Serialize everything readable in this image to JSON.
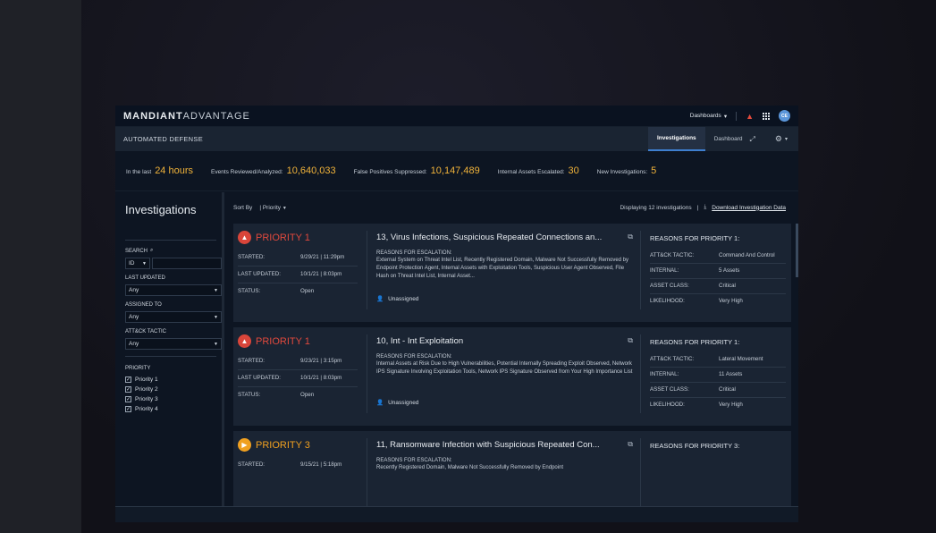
{
  "brand": {
    "bold": "MANDIANT",
    "light": "ADVANTAGE"
  },
  "topbar": {
    "dashboards_label": "Dashboards",
    "avatar_initials": "CE"
  },
  "subbar": {
    "title": "AUTOMATED DEFENSE",
    "tabs": [
      {
        "label": "Investigations",
        "active": true
      },
      {
        "label": "Dashboard",
        "active": false
      }
    ]
  },
  "stats": {
    "range_label": "In the last",
    "range_value": "24 hours",
    "events_label": "Events Reviewed/Analyzed:",
    "events_value": "10,640,033",
    "fp_label": "False Positives Suppressed:",
    "fp_value": "10,147,489",
    "assets_label": "Internal Assets Escalated:",
    "assets_value": "30",
    "new_label": "New Investigations:",
    "new_value": "5"
  },
  "sidebar": {
    "title": "Investigations",
    "search_label": "SEARCH",
    "search_field": "ID",
    "last_updated_label": "LAST UPDATED",
    "last_updated_value": "Any",
    "assigned_label": "ASSIGNED TO",
    "assigned_value": "Any",
    "tactic_label": "ATT&CK TACTIC",
    "tactic_value": "Any",
    "priority_label": "PRIORITY",
    "priorities": [
      "Priority 1",
      "Priority 2",
      "Priority 3",
      "Priority 4"
    ]
  },
  "list": {
    "sort_label": "Sort By",
    "sort_value": "Priority",
    "displaying": "Displaying 12 investigations",
    "download_label": "Download Investigation Data"
  },
  "labels": {
    "started": "STARTED:",
    "last_updated": "LAST UPDATED:",
    "status": "STATUS:",
    "reasons": "REASONS FOR ESCALATION:",
    "unassigned": "Unassigned",
    "tactic": "ATT&CK TACTIC:",
    "internal": "INTERNAL:",
    "asset_class": "ASSET CLASS:",
    "likelihood": "LIKELIHOOD:"
  },
  "cards": [
    {
      "priority": "PRIORITY 1",
      "level": "red",
      "started": "9/29/21 | 11:29pm",
      "last_updated": "10/1/21 | 8:03pm",
      "status": "Open",
      "title": "13, Virus Infections, Suspicious Repeated Connections an...",
      "reasons": "External System on Threat Intel List, Recently Registered Domain, Malware Not Successfully Removed by Endpoint Protection Agent, Internal Assets with Exploitation Tools, Suspicious User Agent Observed, File Hash on Threat Intel List, Internal Asset...",
      "reasons_title": "REASONS FOR PRIORITY 1:",
      "tactic": "Command And Control",
      "internal": "5 Assets",
      "asset_class": "Critical",
      "likelihood": "Very High"
    },
    {
      "priority": "PRIORITY 1",
      "level": "red",
      "started": "9/23/21 | 3:15pm",
      "last_updated": "10/1/21 | 8:03pm",
      "status": "Open",
      "title": "10, Int - Int Exploitation",
      "reasons": "Internal Assets at Risk Due to High Vulnerabilities, Potential Internally Spreading Exploit Observed, Network IPS Signature Involving Exploitation Tools, Network IPS Signature Observed from Your High Importance List",
      "reasons_title": "REASONS FOR PRIORITY 1:",
      "tactic": "Lateral Movement",
      "internal": "11 Assets",
      "asset_class": "Critical",
      "likelihood": "Very High"
    },
    {
      "priority": "PRIORITY 3",
      "level": "orange",
      "started": "9/15/21 | 5:18pm",
      "title": "11, Ransomware Infection with Suspicious Repeated Con...",
      "reasons": "Recently Registered Domain, Malware Not Successfully Removed by Endpoint",
      "reasons_title": "REASONS FOR PRIORITY 3:"
    }
  ]
}
